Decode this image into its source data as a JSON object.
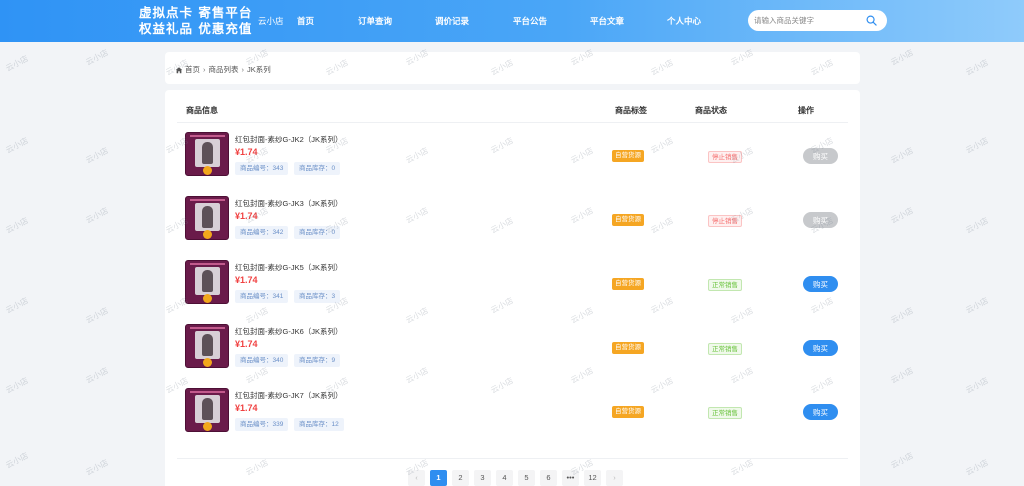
{
  "header": {
    "brand_line1": "虚拟点卡 寄售平台",
    "brand_line2": "权益礼品 优惠充值",
    "shop_name": "云小店",
    "nav": [
      "首页",
      "订单查询",
      "调价记录",
      "平台公告",
      "平台文章",
      "个人中心"
    ],
    "search_placeholder": "请输入商品关键字",
    "search_icon": "search-icon"
  },
  "breadcrumb": {
    "home_icon": "home-icon",
    "items": [
      "首页",
      "商品列表",
      "JK系列"
    ],
    "separator": "›"
  },
  "table": {
    "headers": {
      "info": "商品信息",
      "tag": "商品标签",
      "status": "商品状态",
      "action": "操作"
    },
    "rows": [
      {
        "title": "红包封面-素纱G-JK2（JK系列）",
        "price": "¥1.74",
        "id_text": "商品编号：343",
        "stock_text": "商品库存：0",
        "tag": "自营货源",
        "status": "停止销售",
        "status_type": "stopped",
        "button": "购买",
        "button_enabled": false
      },
      {
        "title": "红包封面-素纱G-JK3（JK系列）",
        "price": "¥1.74",
        "id_text": "商品编号：342",
        "stock_text": "商品库存：0",
        "tag": "自营货源",
        "status": "停止销售",
        "status_type": "stopped",
        "button": "购买",
        "button_enabled": false
      },
      {
        "title": "红包封面-素纱G-JK5（JK系列）",
        "price": "¥1.74",
        "id_text": "商品编号：341",
        "stock_text": "商品库存：3",
        "tag": "自营货源",
        "status": "正常销售",
        "status_type": "on_sale",
        "button": "购买",
        "button_enabled": true
      },
      {
        "title": "红包封面-素纱G-JK6（JK系列）",
        "price": "¥1.74",
        "id_text": "商品编号：340",
        "stock_text": "商品库存：9",
        "tag": "自营货源",
        "status": "正常销售",
        "status_type": "on_sale",
        "button": "购买",
        "button_enabled": true
      },
      {
        "title": "红包封面-素纱G-JK7（JK系列）",
        "price": "¥1.74",
        "id_text": "商品编号：339",
        "stock_text": "商品库存：12",
        "tag": "自营货源",
        "status": "正常销售",
        "status_type": "on_sale",
        "button": "购买",
        "button_enabled": true
      }
    ]
  },
  "pagination": {
    "prev": "‹",
    "pages": [
      "1",
      "2",
      "3",
      "4",
      "5",
      "6",
      "•••",
      "12"
    ],
    "current": "1",
    "next": "›"
  },
  "watermark": "云小店",
  "colors": {
    "header_gradient_start": "#2f93f5",
    "header_gradient_end": "#8fcbfb",
    "price": "#f04141",
    "tag_bg": "#f5a623",
    "primary_button": "#2f8ef0",
    "disabled_button": "#c7c9cc",
    "status_stopped": "#f56c6c",
    "status_on_sale": "#67c23a"
  }
}
